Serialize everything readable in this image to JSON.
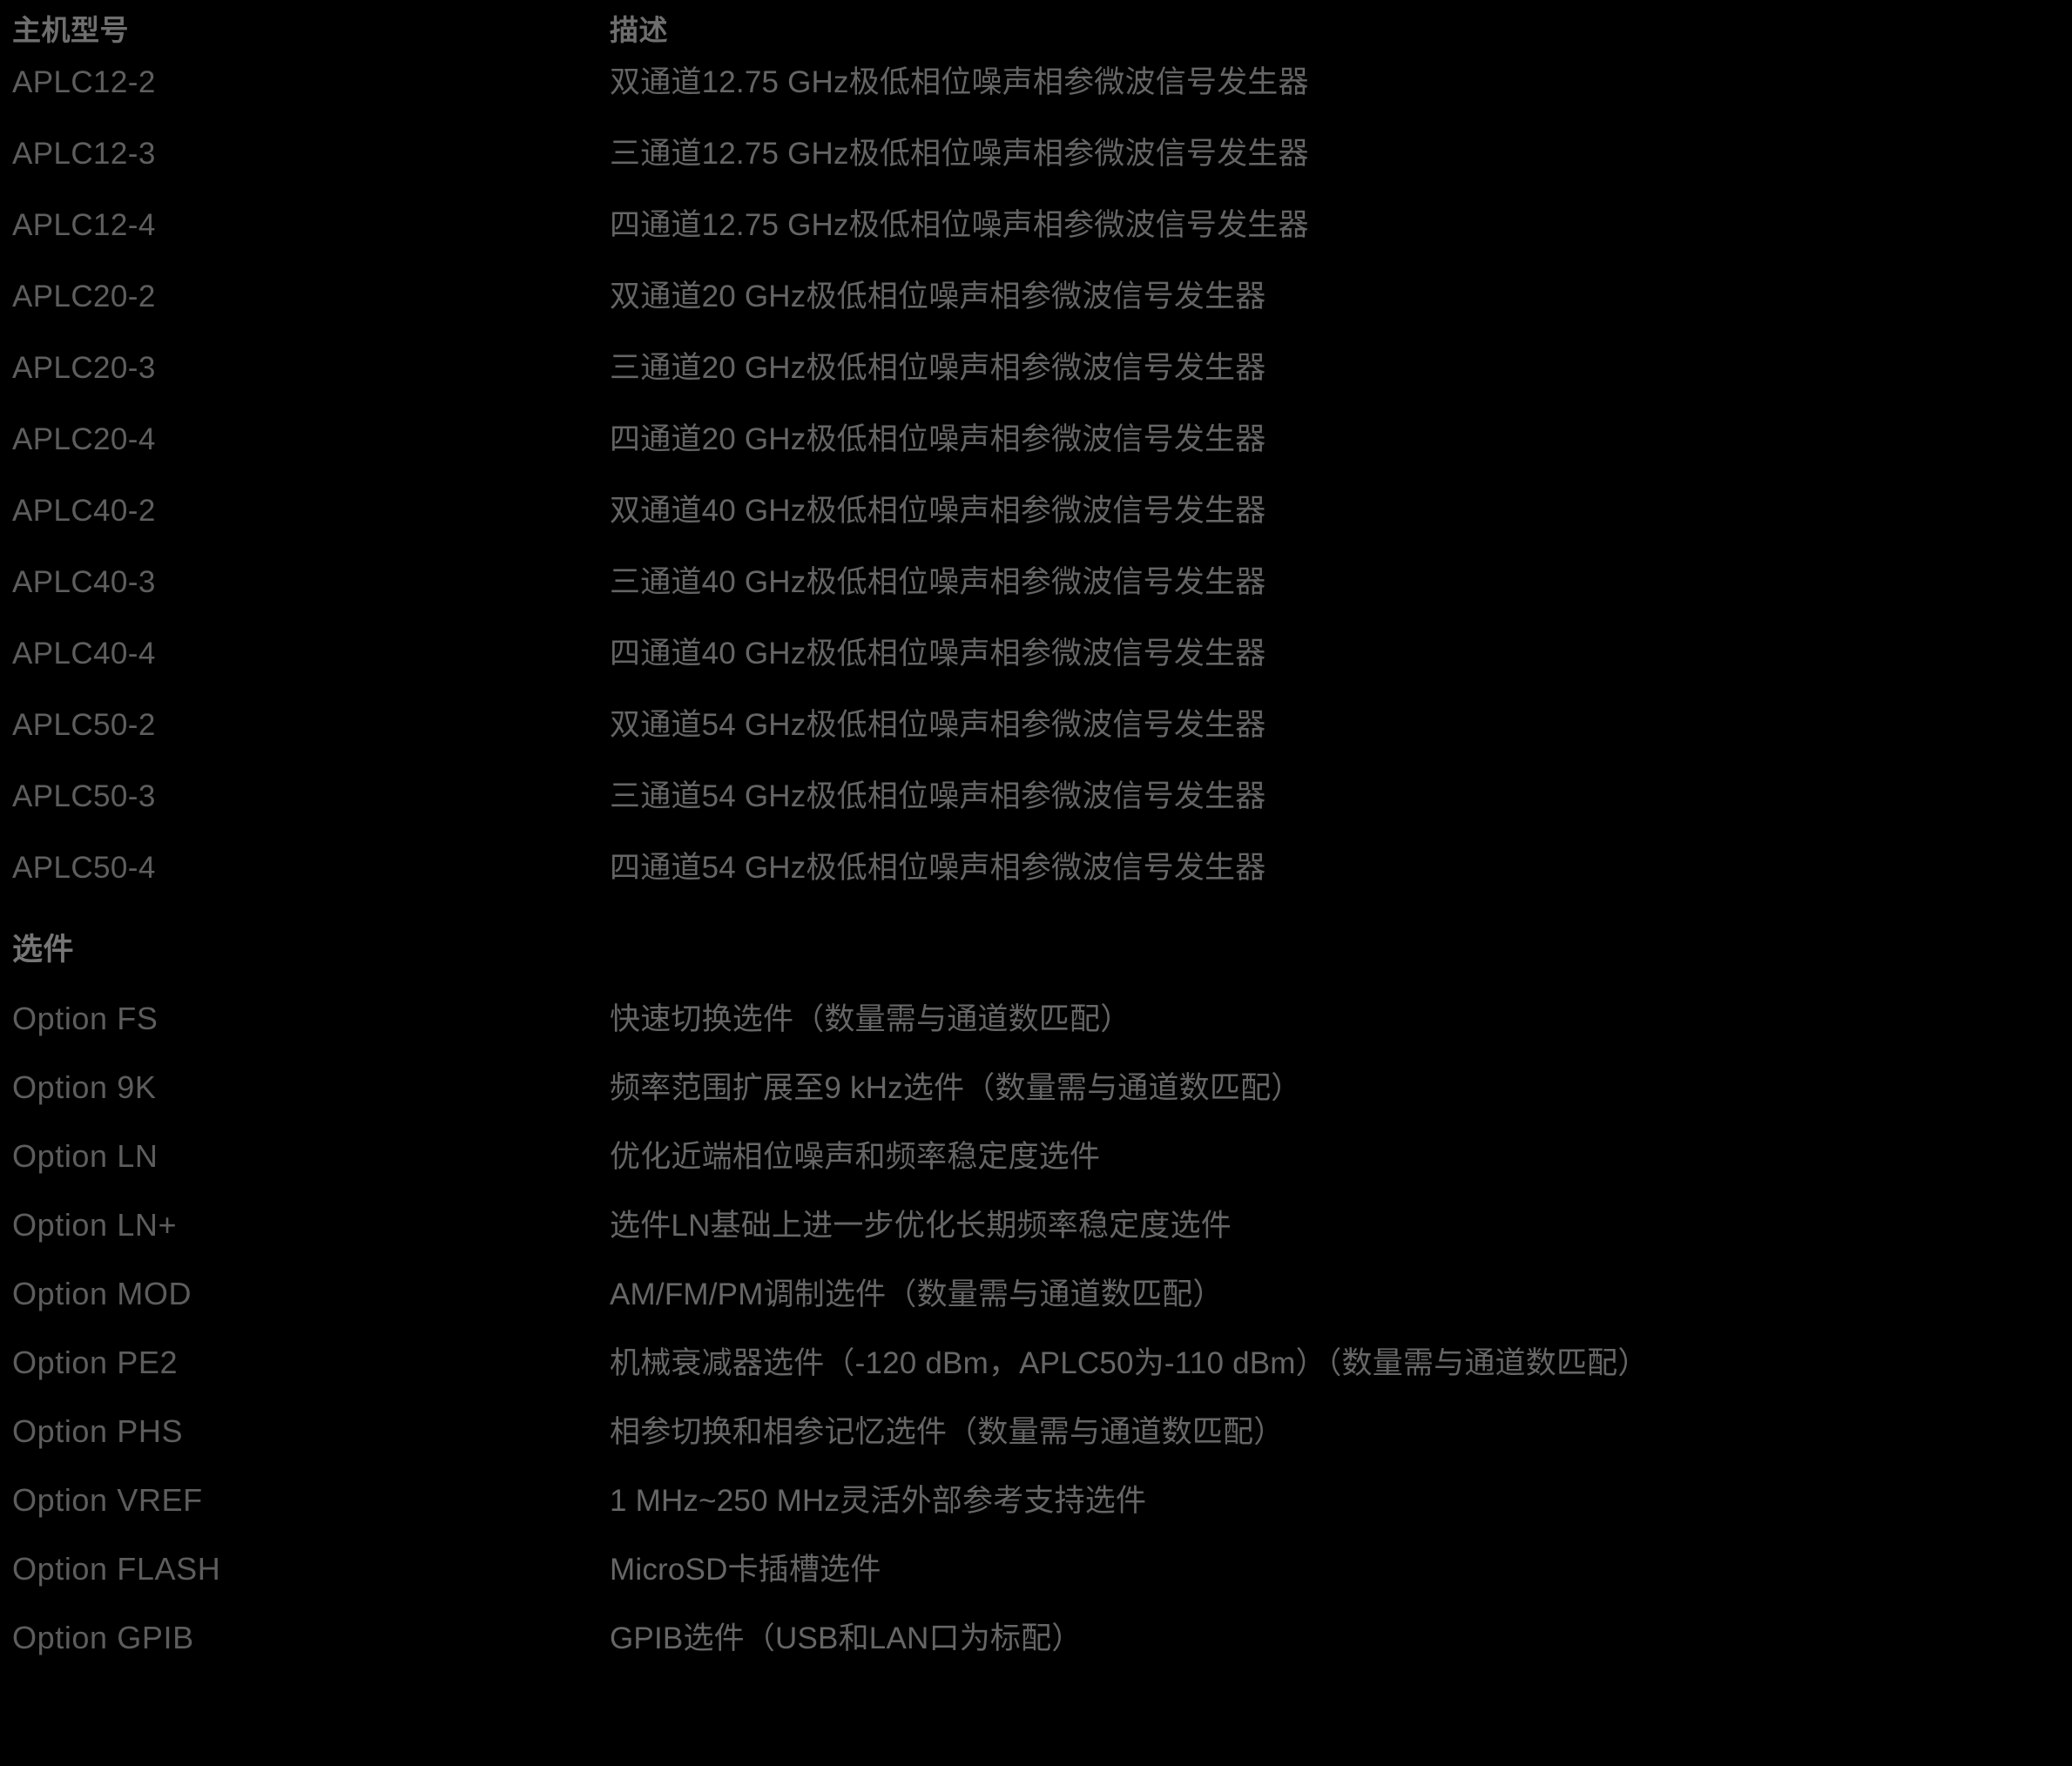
{
  "page": {
    "background_color": "#000000",
    "header_text_color": "#6e6e6e",
    "body_text_color": "#636363"
  },
  "table": {
    "headers": {
      "model": "主机型号",
      "description": "描述"
    },
    "rows": [
      {
        "model": "APLC12-2",
        "description": "双通道12.75 GHz极低相位噪声相参微波信号发生器"
      },
      {
        "model": "APLC12-3",
        "description": "三通道12.75 GHz极低相位噪声相参微波信号发生器"
      },
      {
        "model": "APLC12-4",
        "description": "四通道12.75 GHz极低相位噪声相参微波信号发生器"
      },
      {
        "model": "APLC20-2",
        "description": "双通道20 GHz极低相位噪声相参微波信号发生器"
      },
      {
        "model": "APLC20-3",
        "description": "三通道20 GHz极低相位噪声相参微波信号发生器"
      },
      {
        "model": "APLC20-4",
        "description": "四通道20 GHz极低相位噪声相参微波信号发生器"
      },
      {
        "model": "APLC40-2",
        "description": "双通道40 GHz极低相位噪声相参微波信号发生器"
      },
      {
        "model": "APLC40-3",
        "description": "三通道40 GHz极低相位噪声相参微波信号发生器"
      },
      {
        "model": "APLC40-4",
        "description": "四通道40 GHz极低相位噪声相参微波信号发生器"
      },
      {
        "model": "APLC50-2",
        "description": "双通道54 GHz极低相位噪声相参微波信号发生器"
      },
      {
        "model": "APLC50-3",
        "description": "三通道54 GHz极低相位噪声相参微波信号发生器"
      },
      {
        "model": "APLC50-4",
        "description": "四通道54 GHz极低相位噪声相参微波信号发生器"
      }
    ]
  },
  "options_section": {
    "title": "选件",
    "rows": [
      {
        "model": "Option FS",
        "description": "快速切换选件（数量需与通道数匹配）"
      },
      {
        "model": "Option 9K",
        "description": "频率范围扩展至9 kHz选件（数量需与通道数匹配）"
      },
      {
        "model": "Option LN",
        "description": "优化近端相位噪声和频率稳定度选件"
      },
      {
        "model": "Option LN+",
        "description": "选件LN基础上进一步优化长期频率稳定度选件"
      },
      {
        "model": "Option MOD",
        "description": "AM/FM/PM调制选件（数量需与通道数匹配）"
      },
      {
        "model": "Option PE2",
        "description": "机械衰减器选件（-120 dBm，APLC50为-110 dBm）（数量需与通道数匹配）"
      },
      {
        "model": "Option PHS",
        "description": "相参切换和相参记忆选件（数量需与通道数匹配）"
      },
      {
        "model": "Option VREF",
        "description": "1 MHz~250 MHz灵活外部参考支持选件"
      },
      {
        "model": "Option FLASH",
        "description": "MicroSD卡插槽选件"
      },
      {
        "model": "Option GPIB",
        "description": "GPIB选件（USB和LAN口为标配）"
      }
    ]
  }
}
